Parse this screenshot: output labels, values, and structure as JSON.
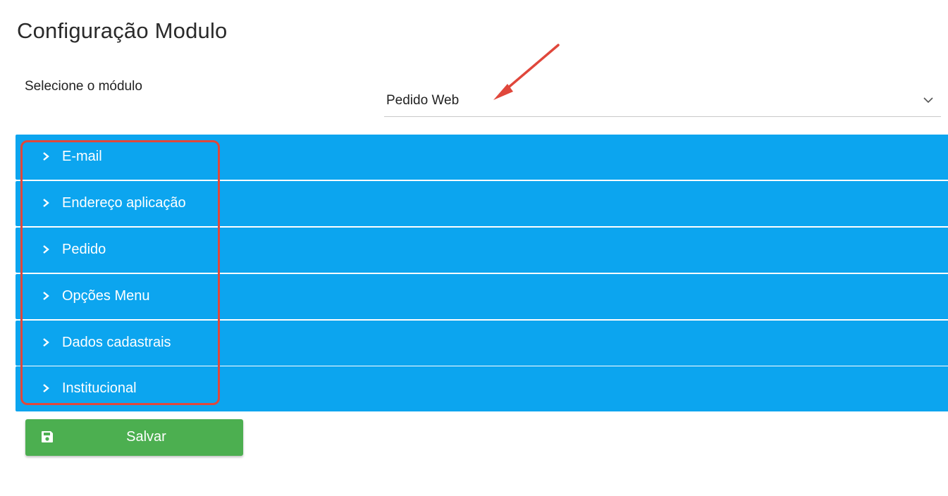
{
  "page": {
    "title": "Configuração Modulo"
  },
  "module_select": {
    "label": "Selecione o módulo",
    "value": "Pedido Web"
  },
  "accordion": {
    "items": [
      {
        "label": "E-mail"
      },
      {
        "label": "Endereço aplicação"
      },
      {
        "label": "Pedido"
      },
      {
        "label": "Opções Menu"
      },
      {
        "label": "Dados cadastrais"
      },
      {
        "label": "Institucional"
      }
    ]
  },
  "actions": {
    "save_label": "Salvar"
  },
  "colors": {
    "accordion_bg": "#0ca5ef",
    "save_bg": "#4caf50",
    "annotation": "#e0473b"
  },
  "icons": {
    "select_toggle": "chevron-down-icon",
    "accordion_toggle": "chevron-right-icon",
    "save": "floppy-disk-icon"
  }
}
